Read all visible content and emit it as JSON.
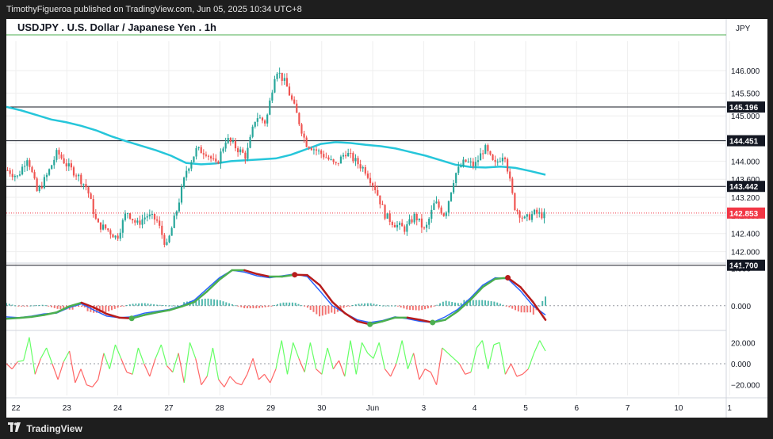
{
  "header": {
    "published_text": "TimothyFigueroa published on TradingView.com, Jun 05, 2025 10:34 UTC+8",
    "symbol_title": "USDJPY . U.S. Dollar / Japanese Yen . 1h",
    "currency": "JPY"
  },
  "footer": {
    "brand": "TradingView"
  },
  "colors": {
    "up": "#26a69a",
    "down": "#ef5350",
    "ma": "#26c6da",
    "macd_fast": "#2962ff",
    "macd_signal_up": "#4caf50",
    "macd_signal_down": "#b71c1c",
    "hist_up": "#26a69a",
    "hist_down": "#ef5350",
    "osc_up": "#66ff66",
    "osc_down": "#ff6666",
    "last_price": "#f23645",
    "grid": "#eeeeee"
  },
  "chart_data": [
    {
      "type": "candlestick",
      "title": "USDJPY . U.S. Dollar / Japanese Yen . 1h",
      "x_ticks": [
        "22",
        "23",
        "24",
        "27",
        "28",
        "29",
        "30",
        "Jun",
        "3",
        "4",
        "5",
        "6",
        "7",
        "10",
        "1"
      ],
      "y_ticks": [
        146.0,
        145.5,
        145.0,
        144.4,
        144.0,
        143.6,
        143.2,
        142.8,
        142.4,
        142.0
      ],
      "ylim": [
        141.8,
        146.65
      ],
      "horizontal_levels": [
        145.196,
        144.451,
        143.442,
        141.7
      ],
      "last_price": 142.853,
      "moving_average": [
        145.2,
        145.12,
        145.02,
        144.92,
        144.86,
        144.78,
        144.68,
        144.55,
        144.44,
        144.34,
        144.24,
        144.12,
        143.96,
        143.93,
        143.95,
        144.0,
        144.02,
        144.04,
        144.06,
        144.14,
        144.26,
        144.38,
        144.42,
        144.4,
        144.36,
        144.33,
        144.28,
        144.2,
        144.12,
        144.02,
        143.92,
        143.87,
        143.86,
        143.88,
        143.85,
        143.78,
        143.7
      ],
      "price_path": [
        143.8,
        143.65,
        144.1,
        143.3,
        143.7,
        144.2,
        143.9,
        143.7,
        143.4,
        142.6,
        142.5,
        142.3,
        142.9,
        142.6,
        142.8,
        142.7,
        142.1,
        142.9,
        143.8,
        144.25,
        144.2,
        143.9,
        144.5,
        144.3,
        144.1,
        145.0,
        144.85,
        146.05,
        145.7,
        145.1,
        144.4,
        144.25,
        144.1,
        143.9,
        144.2,
        144.0,
        143.8,
        143.4,
        142.8,
        142.6,
        142.5,
        142.8,
        142.45,
        143.1,
        142.8,
        143.7,
        144.0,
        143.9,
        144.3,
        143.9,
        144.2,
        143.0,
        142.7,
        142.85,
        142.8
      ]
    },
    {
      "type": "line",
      "name_hidden": true,
      "y_ticks": [
        1.0,
        0.0
      ],
      "ylim": [
        -0.6,
        1.1
      ],
      "fast": [
        -0.3,
        -0.32,
        -0.28,
        -0.22,
        -0.2,
        -0.05,
        0.05,
        -0.12,
        -0.28,
        -0.32,
        -0.3,
        -0.2,
        -0.15,
        -0.1,
        0.0,
        0.15,
        0.45,
        0.75,
        0.95,
        0.9,
        0.8,
        0.75,
        0.8,
        0.85,
        0.78,
        0.4,
        0.0,
        -0.2,
        -0.38,
        -0.45,
        -0.4,
        -0.3,
        -0.35,
        -0.42,
        -0.45,
        -0.3,
        -0.1,
        0.2,
        0.55,
        0.75,
        0.72,
        0.4,
        0.0,
        -0.25
      ],
      "signal": [
        -0.35,
        -0.33,
        -0.3,
        -0.25,
        -0.18,
        -0.02,
        0.08,
        -0.05,
        -0.22,
        -0.32,
        -0.34,
        -0.25,
        -0.18,
        -0.12,
        -0.02,
        0.1,
        0.38,
        0.7,
        0.95,
        0.95,
        0.85,
        0.78,
        0.78,
        0.83,
        0.82,
        0.55,
        0.1,
        -0.2,
        -0.42,
        -0.5,
        -0.42,
        -0.32,
        -0.32,
        -0.38,
        -0.45,
        -0.38,
        -0.15,
        0.15,
        0.5,
        0.72,
        0.75,
        0.5,
        0.1,
        -0.38
      ]
    },
    {
      "type": "line",
      "y_ticks": [
        20.0,
        0.0,
        -20.0
      ],
      "ylim": [
        -30,
        30
      ],
      "values": [
        0,
        -5,
        2,
        3,
        25,
        -10,
        5,
        15,
        0,
        -15,
        2,
        12,
        -18,
        -5,
        -20,
        -22,
        -15,
        10,
        -5,
        18,
        5,
        -8,
        -10,
        15,
        0,
        -12,
        5,
        18,
        -2,
        -8,
        10,
        -18,
        20,
        5,
        -20,
        -12,
        15,
        -15,
        -22,
        -12,
        -18,
        -20,
        -10,
        5,
        -15,
        -10,
        -18,
        -5,
        22,
        -10,
        20,
        5,
        -8,
        20,
        -5,
        -10,
        15,
        -5,
        3,
        -12,
        22,
        -10,
        20,
        10,
        5,
        20,
        -5,
        -12,
        0,
        22,
        -5,
        10,
        -15,
        -5,
        -8,
        -20,
        15,
        10,
        5,
        0,
        -10,
        -8,
        15,
        22,
        -5,
        18,
        20,
        -10,
        0,
        -12,
        -10,
        -5,
        10,
        22,
        12
      ]
    }
  ]
}
